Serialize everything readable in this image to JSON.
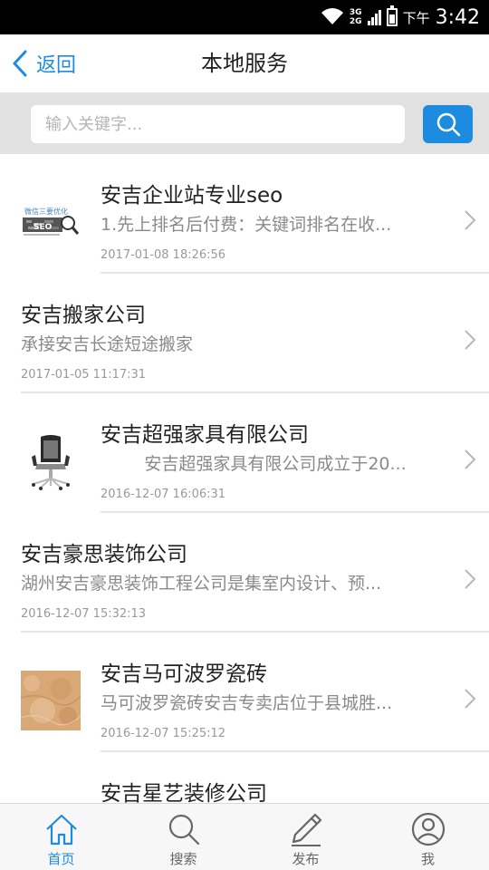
{
  "status_bar": {
    "net_top": "3G",
    "net_bottom": "2G",
    "time_prefix": "下午",
    "time": "3:42"
  },
  "nav": {
    "back_label": "返回",
    "title": "本地服务"
  },
  "search": {
    "placeholder": "输入关键字...",
    "button_icon": "search-icon"
  },
  "listings": [
    {
      "title": "安吉企业站专业seo",
      "desc": "1.先上排名后付费：关键词排名在收...",
      "date": "2017-01-08 18:26:56",
      "thumb": "seo-thumbnail"
    },
    {
      "title": "安吉搬家公司",
      "desc": "承接安吉长途短途搬家",
      "date": "2017-01-05 11:17:31",
      "thumb": ""
    },
    {
      "title": "安吉超强家具有限公司",
      "desc": "        安吉超强家具有限公司成立于20...",
      "date": "2016-12-07 16:06:31",
      "thumb": "office-chair-thumbnail"
    },
    {
      "title": "安吉豪思装饰公司",
      "desc": "湖州安吉豪思装饰工程公司是集室内设计、预...",
      "date": "2016-12-07 15:32:13",
      "thumb": ""
    },
    {
      "title": "安吉马可波罗瓷砖",
      "desc": "马可波罗瓷砖安吉专卖店位于县城胜...",
      "date": "2016-12-07 15:25:12",
      "thumb": "marble-tile-thumbnail"
    },
    {
      "title": "安吉星艺装修公司",
      "desc": "",
      "date": "",
      "thumb": ""
    }
  ],
  "tabs": [
    {
      "label": "首页",
      "icon": "home-icon",
      "active": true
    },
    {
      "label": "搜索",
      "icon": "search-icon",
      "active": false
    },
    {
      "label": "发布",
      "icon": "pencil-icon",
      "active": false
    },
    {
      "label": "我",
      "icon": "user-icon",
      "active": false
    }
  ],
  "colors": {
    "accent": "#1e8be0",
    "search_bg": "#e1e1e1",
    "status_bar": "#000000"
  }
}
